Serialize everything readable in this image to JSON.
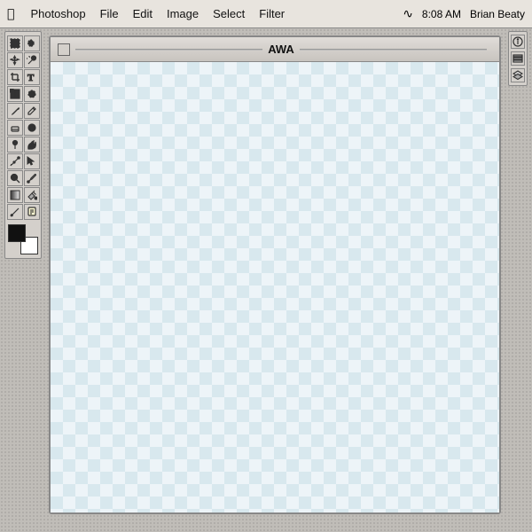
{
  "menubar": {
    "apple": "⌘",
    "items": [
      {
        "label": "Photoshop"
      },
      {
        "label": "File"
      },
      {
        "label": "Edit"
      },
      {
        "label": "Image"
      },
      {
        "label": "Select"
      },
      {
        "label": "Filter"
      }
    ],
    "wifi": "📶",
    "time": "8:08 AM",
    "user": "Brian Beaty"
  },
  "window": {
    "title": "AWA"
  },
  "tools": {
    "rows": [
      [
        "marquee",
        "lasso"
      ],
      [
        "move",
        "magic-wand"
      ],
      [
        "crop",
        "text"
      ],
      [
        "slice",
        "patch"
      ],
      [
        "brush",
        "pencil"
      ],
      [
        "eraser",
        "blur"
      ],
      [
        "dodge",
        "burn"
      ],
      [
        "pen",
        "path"
      ],
      [
        "zoom",
        "eyedropper"
      ],
      [
        "gradient",
        "paint-bucket"
      ],
      [
        "measure",
        "notes"
      ]
    ]
  },
  "right_panel": {
    "buttons": [
      "info",
      "channels",
      "layers"
    ]
  }
}
